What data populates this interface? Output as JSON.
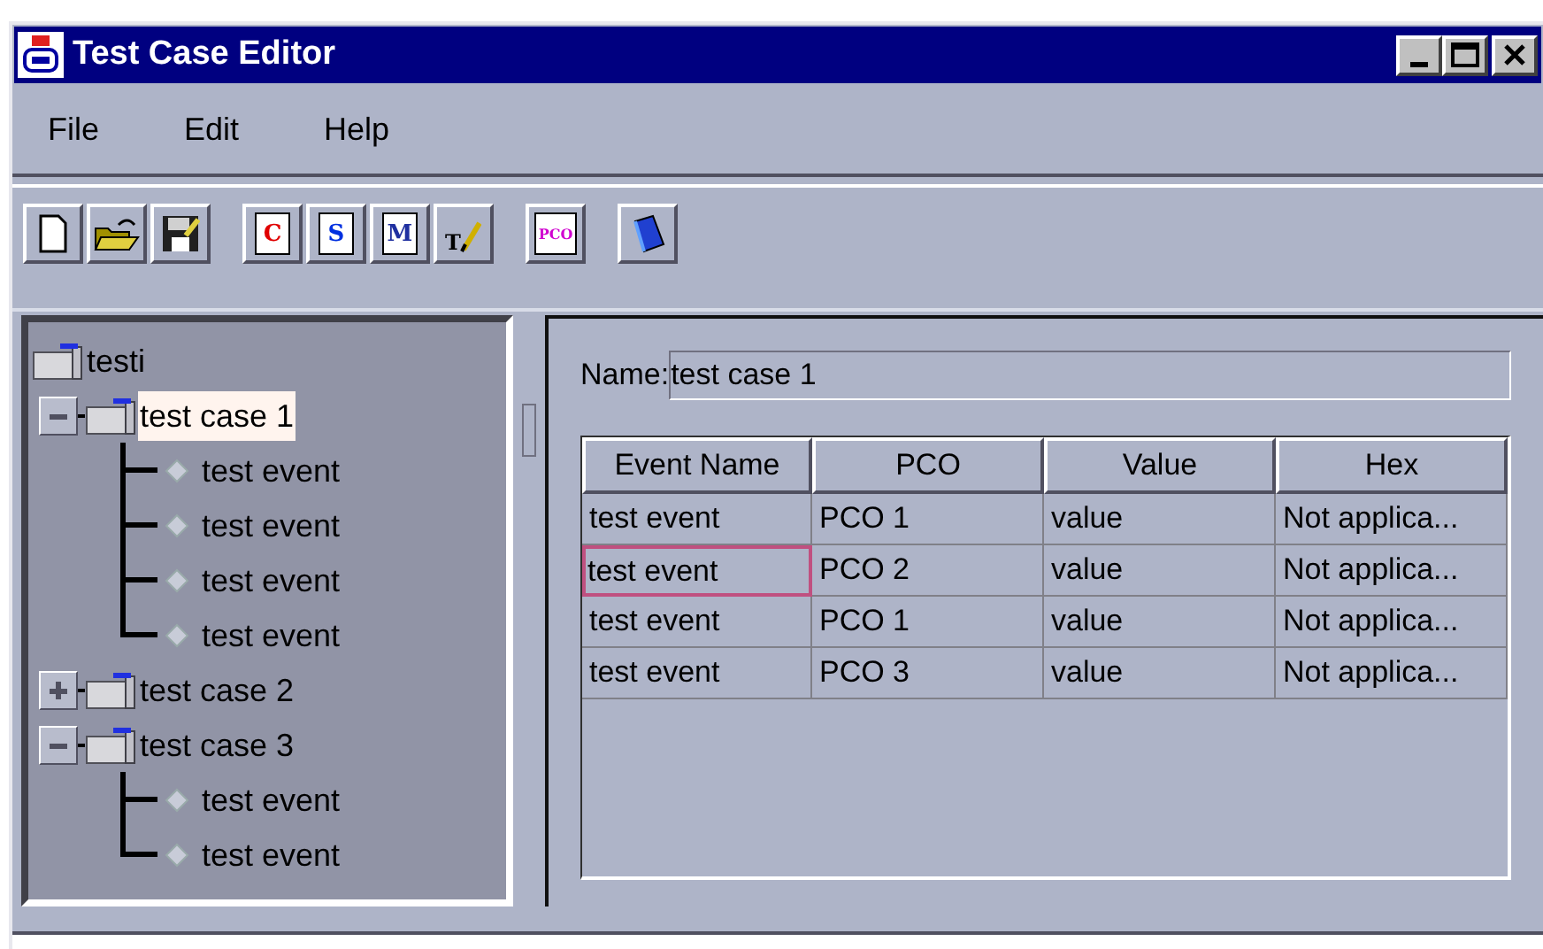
{
  "window": {
    "title": "Test Case Editor"
  },
  "menu": [
    "File",
    "Edit",
    "Help"
  ],
  "toolbar": [
    {
      "kind": "new"
    },
    {
      "kind": "open"
    },
    {
      "kind": "save"
    },
    {
      "kind": "doc",
      "glyph": "C",
      "color": "#e00000"
    },
    {
      "kind": "doc",
      "glyph": "S",
      "color": "#0030e0"
    },
    {
      "kind": "doc",
      "glyph": "M",
      "color": "#2030a0"
    },
    {
      "kind": "pen",
      "glyph": "T"
    },
    {
      "kind": "doc",
      "glyph": "PCO",
      "color": "#d000d0"
    },
    {
      "kind": "book"
    }
  ],
  "tree": {
    "label": "testi",
    "kind": "root",
    "selected": false,
    "children": [
      {
        "label": "test case 1",
        "kind": "case",
        "expanded": true,
        "selected": true,
        "children": [
          {
            "label": "test event",
            "kind": "event",
            "selected": false
          },
          {
            "label": "test event",
            "kind": "event",
            "selected": false
          },
          {
            "label": "test event",
            "kind": "event",
            "selected": false
          },
          {
            "label": "test event",
            "kind": "event",
            "selected": false
          }
        ]
      },
      {
        "label": "test case 2",
        "kind": "case",
        "expanded": false,
        "selected": false
      },
      {
        "label": "test case 3",
        "kind": "case",
        "expanded": true,
        "selected": false,
        "children": [
          {
            "label": "test event",
            "kind": "event",
            "selected": false
          },
          {
            "label": "test event",
            "kind": "event",
            "selected": false
          }
        ]
      }
    ]
  },
  "name_field": {
    "label": "Name:",
    "value": "test case 1"
  },
  "table": {
    "columns": [
      "Event Name",
      "PCO",
      "Value",
      "Hex"
    ],
    "rows": [
      {
        "cells": [
          "test event",
          "PCO 1",
          "value",
          "Not applica..."
        ],
        "focused": false
      },
      {
        "cells": [
          "test event",
          "PCO 2",
          "value",
          "Not applica..."
        ],
        "focused": true
      },
      {
        "cells": [
          "test event",
          "PCO 1",
          "value",
          "Not applica..."
        ],
        "focused": false
      },
      {
        "cells": [
          "test event",
          "PCO 3",
          "value",
          "Not applica..."
        ],
        "focused": false
      }
    ]
  }
}
